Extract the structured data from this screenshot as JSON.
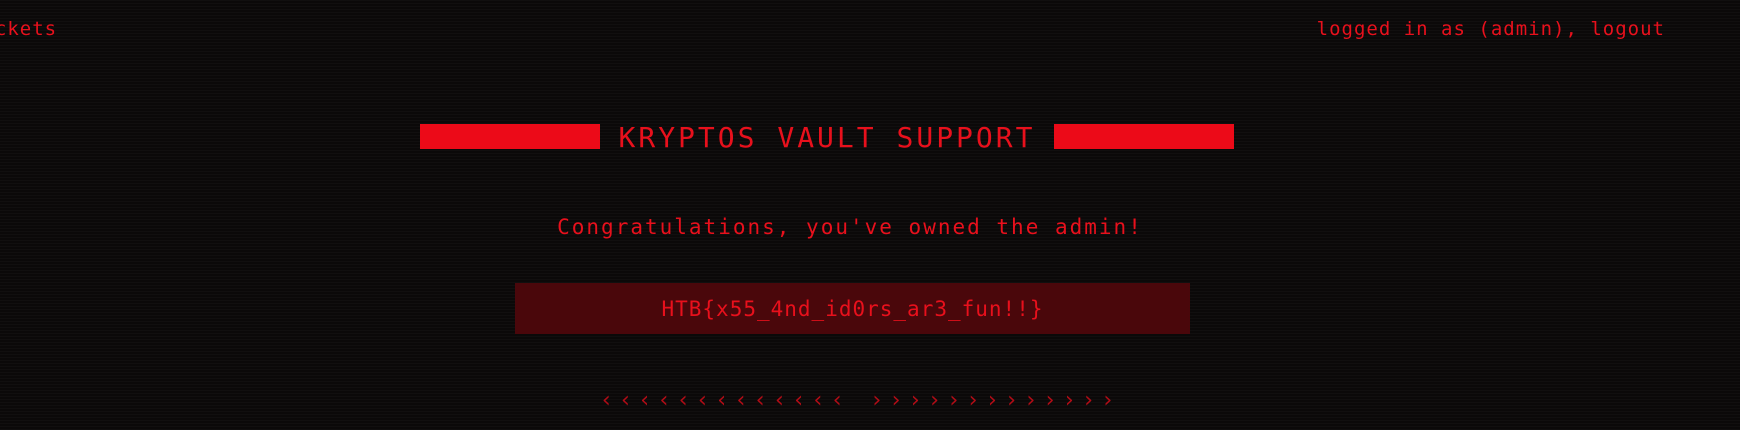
{
  "nav": {
    "left_link": "tickets",
    "user_prefix": "logged in as ",
    "username": "(admin)",
    "separator": ", ",
    "logout": "logout"
  },
  "header": {
    "title": "KRYPTOS VAULT SUPPORT"
  },
  "main": {
    "message": "Congratulations, you've owned the admin!",
    "flag": "HTB{x55_4nd_id0rs_ar3_fun!!}"
  },
  "footer": {
    "left_chevrons": "‹‹‹‹‹‹‹‹‹‹‹‹‹",
    "right_chevrons": "›››››››››››››"
  },
  "colors": {
    "accent": "#e8101c",
    "bar": "#ec0a18",
    "flag_bg": "#4a070b",
    "background": "#0b0909"
  }
}
